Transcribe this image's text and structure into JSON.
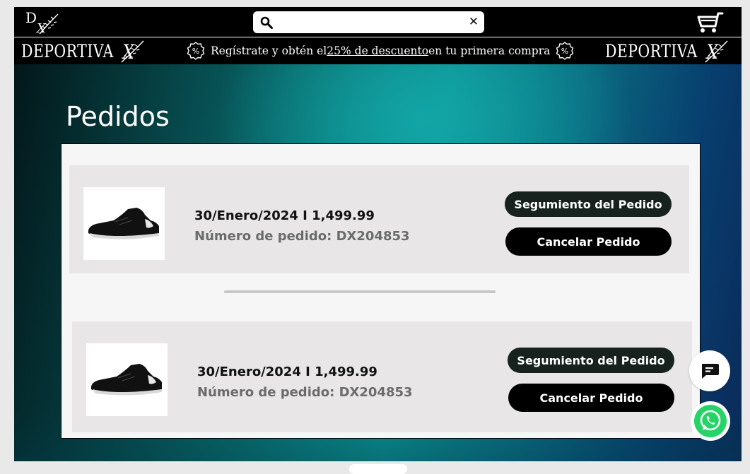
{
  "header": {
    "logo_icon": "dx-logo-icon",
    "search": {
      "value": "",
      "placeholder": ""
    },
    "cart_icon": "shopping-cart-icon"
  },
  "promo": {
    "brand": "DEPORTIVA",
    "text_before": "Regístrate y obtén el ",
    "text_link": "25% de descuento",
    "text_after": " en tu primera compra",
    "badge_icon": "percent-badge-icon"
  },
  "main": {
    "title": "Pedidos",
    "orders": [
      {
        "date_price": "30/Enero/2024 I 1,499.99",
        "order_number": "Número de pedido: DX204853",
        "track_label": "Segumiento del Pedido",
        "cancel_label": "Cancelar Pedido"
      },
      {
        "date_price": "30/Enero/2024 I 1,499.99",
        "order_number": "Número de pedido: DX204853",
        "track_label": "Segumiento del Pedido",
        "cancel_label": "Cancelar Pedido"
      }
    ]
  },
  "floating": {
    "chat_icon": "chat-bubble-icon",
    "whatsapp_icon": "whatsapp-icon"
  },
  "colors": {
    "header_bg": "#000000",
    "button_dark": "#17221f",
    "teal_accent": "#0b8f91"
  }
}
